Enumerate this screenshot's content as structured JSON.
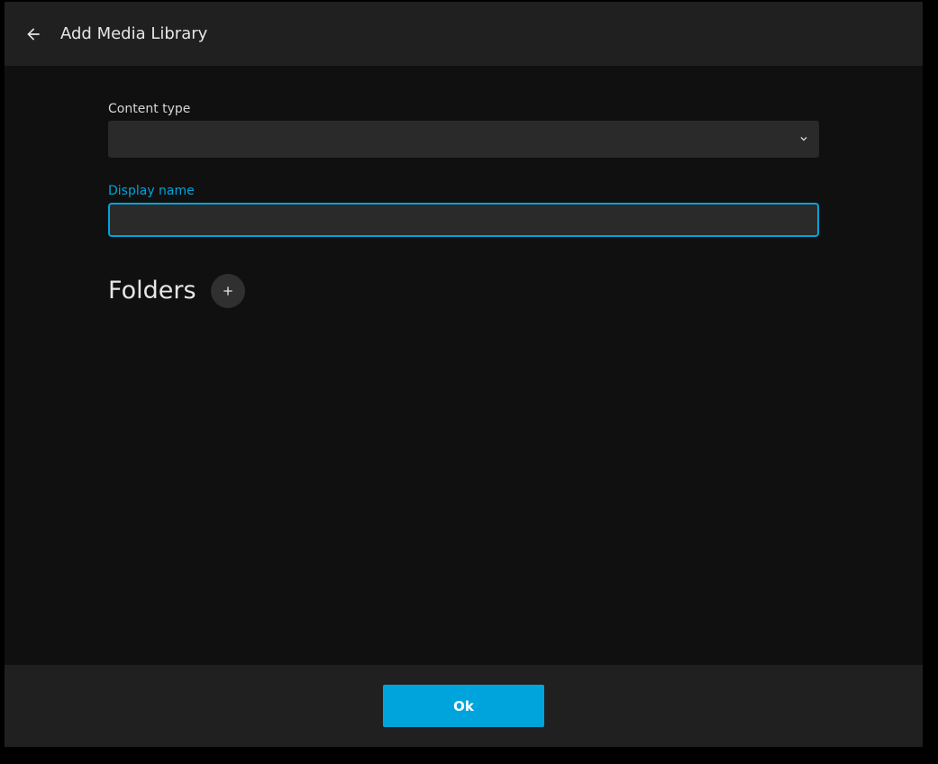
{
  "header": {
    "back_icon": "arrow-left-icon",
    "title": "Add Media Library"
  },
  "form": {
    "content_type": {
      "label": "Content type",
      "selected_value": "",
      "icon": "chevron-down-icon"
    },
    "display_name": {
      "label": "Display name",
      "value": "",
      "placeholder": ""
    }
  },
  "folders": {
    "title": "Folders",
    "add_icon": "plus-icon"
  },
  "footer": {
    "ok_label": "Ok"
  },
  "colors": {
    "accent": "#00a4dc",
    "background": "#101010",
    "header_background": "#202020",
    "field_background": "#2a2a2a"
  }
}
